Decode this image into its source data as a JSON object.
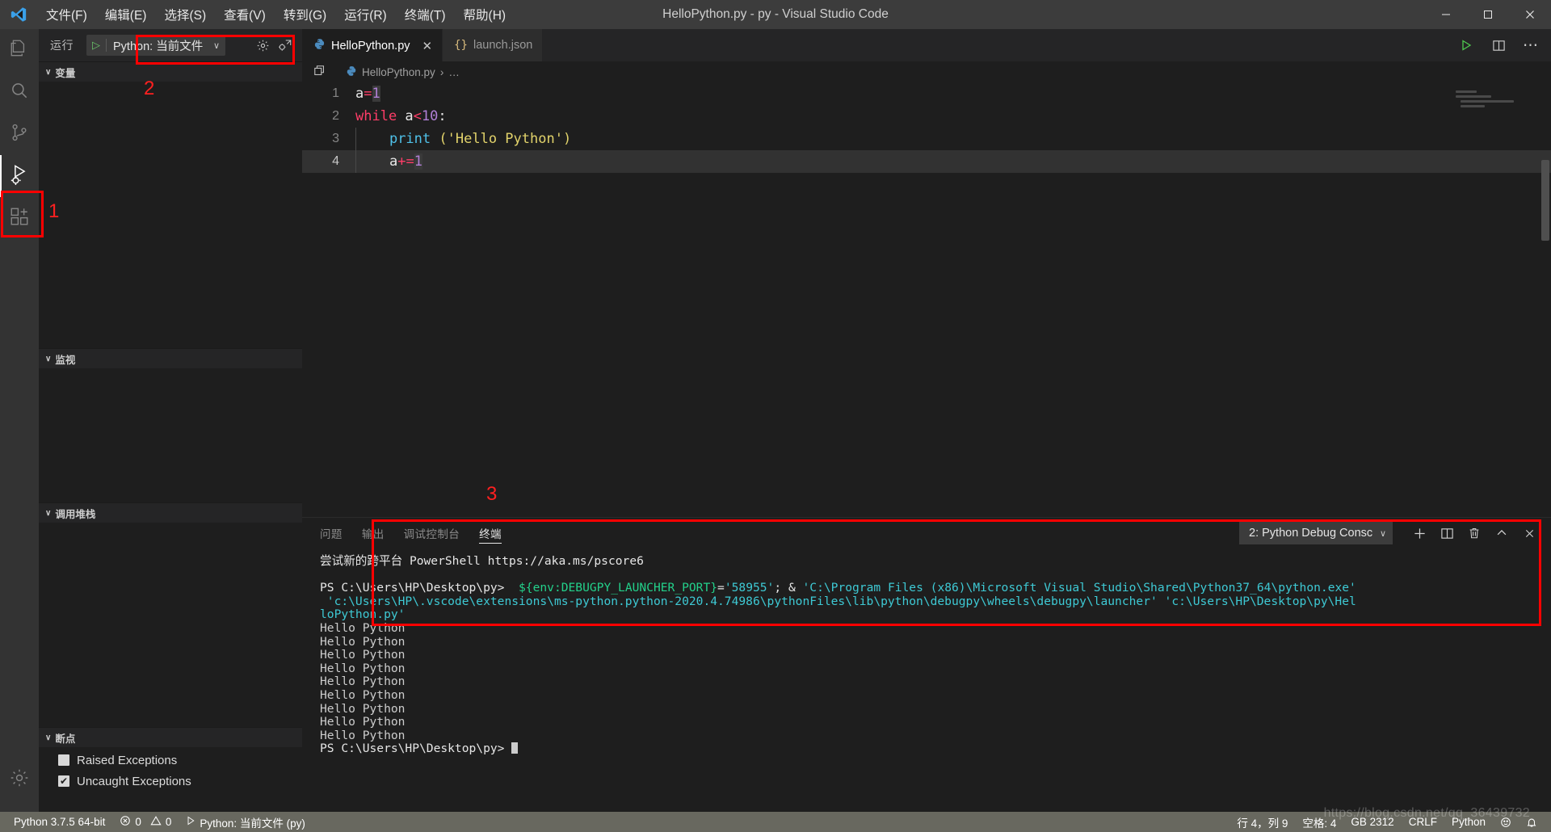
{
  "window": {
    "title": "HelloPython.py - py - Visual Studio Code",
    "logo": "vscode-logo",
    "minimize": "─",
    "maximize": "□",
    "close": "✕"
  },
  "menubar": {
    "items": [
      {
        "label": "文件(F)",
        "name": "menu-file"
      },
      {
        "label": "编辑(E)",
        "name": "menu-edit"
      },
      {
        "label": "选择(S)",
        "name": "menu-selection"
      },
      {
        "label": "查看(V)",
        "name": "menu-view"
      },
      {
        "label": "转到(G)",
        "name": "menu-go"
      },
      {
        "label": "运行(R)",
        "name": "menu-run"
      },
      {
        "label": "终端(T)",
        "name": "menu-terminal"
      },
      {
        "label": "帮助(H)",
        "name": "menu-help"
      }
    ]
  },
  "activitybar": {
    "items": [
      {
        "name": "explorer-icon",
        "label": "资源管理器",
        "active": false
      },
      {
        "name": "search-icon",
        "label": "搜索",
        "active": false
      },
      {
        "name": "source-control-icon",
        "label": "源代码管理",
        "active": false
      },
      {
        "name": "run-and-debug-icon",
        "label": "运行和调试",
        "active": true
      },
      {
        "name": "extensions-icon",
        "label": "扩展",
        "active": false
      }
    ],
    "settings": {
      "name": "manage-gear-icon",
      "label": "管理"
    }
  },
  "sidebar": {
    "title": "运行",
    "run_config": {
      "label": "Python: 当前文件",
      "play_glyph": "▷",
      "chevron": "∨"
    },
    "header_icons": [
      {
        "name": "gear-icon",
        "glyph": "⚙"
      },
      {
        "name": "debug-console-icon",
        "glyph": "⚙"
      }
    ],
    "sections": [
      {
        "name": "variables",
        "label": "变量",
        "twisty": "∨",
        "items": []
      },
      {
        "name": "watch",
        "label": "监视",
        "twisty": "∨",
        "items": []
      },
      {
        "name": "call-stack",
        "label": "调用堆栈",
        "twisty": "∨",
        "items": []
      },
      {
        "name": "breakpoints",
        "label": "断点",
        "twisty": "∨",
        "items": []
      }
    ],
    "breakpoints": [
      {
        "label": "Raised Exceptions",
        "checked": false
      },
      {
        "label": "Uncaught Exceptions",
        "checked": true
      }
    ]
  },
  "editor": {
    "tabs": [
      {
        "label": "HelloPython.py",
        "icon": "python-file-icon",
        "active": true,
        "close": "✕"
      },
      {
        "label": "launch.json",
        "icon": "json-file-icon",
        "active": false,
        "close": ""
      }
    ],
    "tab_actions": [
      {
        "name": "run-python-file-icon",
        "glyph": "▷"
      },
      {
        "name": "split-editor-icon",
        "glyph": "◫"
      },
      {
        "name": "more-actions-icon",
        "glyph": "⋯"
      }
    ],
    "breadcrumb": {
      "file": "HelloPython.py",
      "separator": "›",
      "tail": "…"
    },
    "lines": [
      {
        "number": "1",
        "text": "a=1",
        "active": false
      },
      {
        "number": "2",
        "text": "while a<10:",
        "active": false
      },
      {
        "number": "3",
        "text": "    print ('Hello Python')",
        "active": false
      },
      {
        "number": "4",
        "text": "    a+=1",
        "active": true
      }
    ]
  },
  "panel": {
    "tabs": [
      {
        "label": "问题",
        "name": "tab-problems",
        "active": false
      },
      {
        "label": "输出",
        "name": "tab-output",
        "active": false
      },
      {
        "label": "调试控制台",
        "name": "tab-debug-console",
        "active": false
      },
      {
        "label": "终端",
        "name": "tab-terminal",
        "active": true
      }
    ],
    "terminal_select": {
      "value": "2: Python Debug Consc",
      "chevron": "∨"
    },
    "actions": [
      {
        "name": "new-terminal-icon",
        "glyph": "＋"
      },
      {
        "name": "split-terminal-icon",
        "glyph": "◫"
      },
      {
        "name": "kill-terminal-icon",
        "glyph": "🗑"
      },
      {
        "name": "maximize-panel-icon",
        "glyph": "∧"
      },
      {
        "name": "close-panel-icon",
        "glyph": "✕"
      }
    ],
    "terminal_output": [
      {
        "parts": [
          {
            "text": "尝试新的跨平台 PowerShell https://aka.ms/pscore6",
            "color": "white"
          }
        ]
      },
      {
        "parts": [
          {
            "text": "",
            "color": "white"
          }
        ]
      },
      {
        "parts": [
          {
            "text": "PS C:\\Users\\HP\\Desktop\\py> ",
            "color": "white"
          },
          {
            "text": " ${env:DEBUGPY_LAUNCHER_PORT}",
            "color": "green"
          },
          {
            "text": "=",
            "color": "white"
          },
          {
            "text": "'58955'",
            "color": "cyan"
          },
          {
            "text": "; ",
            "color": "white"
          },
          {
            "text": "& ",
            "color": "white"
          },
          {
            "text": "'C:\\Program Files (x86)\\Microsoft Visual Studio\\Shared\\Python37_64\\python.exe'",
            "color": "cyan"
          }
        ]
      },
      {
        "parts": [
          {
            "text": " 'c:\\Users\\HP\\.vscode\\extensions\\ms-python.python-2020.4.74986\\pythonFiles\\lib\\python\\debugpy\\wheels\\debugpy\\launcher' 'c:\\Users\\HP\\Desktop\\py\\Hel",
            "color": "cyan"
          }
        ]
      },
      {
        "parts": [
          {
            "text": "loPython.py'",
            "color": "cyan"
          }
        ]
      },
      {
        "parts": [
          {
            "text": "Hello Python",
            "color": "gray"
          }
        ]
      },
      {
        "parts": [
          {
            "text": "Hello Python",
            "color": "gray"
          }
        ]
      },
      {
        "parts": [
          {
            "text": "Hello Python",
            "color": "gray"
          }
        ]
      },
      {
        "parts": [
          {
            "text": "Hello Python",
            "color": "gray"
          }
        ]
      },
      {
        "parts": [
          {
            "text": "Hello Python",
            "color": "gray"
          }
        ]
      },
      {
        "parts": [
          {
            "text": "Hello Python",
            "color": "gray"
          }
        ]
      },
      {
        "parts": [
          {
            "text": "Hello Python",
            "color": "gray"
          }
        ]
      },
      {
        "parts": [
          {
            "text": "Hello Python",
            "color": "gray"
          }
        ]
      },
      {
        "parts": [
          {
            "text": "Hello Python",
            "color": "gray"
          }
        ]
      },
      {
        "parts": [
          {
            "text": "PS C:\\Users\\HP\\Desktop\\py> ",
            "color": "white",
            "cursor": true
          }
        ]
      }
    ]
  },
  "statusbar": {
    "left": [
      {
        "name": "python-interpreter",
        "label": "Python 3.7.5 64-bit"
      },
      {
        "name": "problems-counts",
        "label": "0",
        "label2": "0",
        "error_glyph": "ⓧ",
        "warn_glyph": "⚠"
      },
      {
        "name": "run-config-status",
        "label": "Python: 当前文件 (py)",
        "glyph": "▷"
      }
    ],
    "right": [
      {
        "name": "cursor-position",
        "label": "行 4，列 9"
      },
      {
        "name": "indentation",
        "label": "空格: 4"
      },
      {
        "name": "encoding",
        "label": "GB 2312"
      },
      {
        "name": "eol",
        "label": "CRLF"
      },
      {
        "name": "language-mode",
        "label": "Python"
      },
      {
        "name": "feedback-icon",
        "label": "☺"
      },
      {
        "name": "notifications-bell-icon",
        "label": "ὑ4"
      }
    ]
  },
  "annotations": [
    {
      "name": "annotation-1",
      "number": "1"
    },
    {
      "name": "annotation-2",
      "number": "2"
    },
    {
      "name": "annotation-3",
      "number": "3"
    }
  ],
  "watermark": {
    "text": "https://blog.csdn.net/qq_36439732"
  }
}
